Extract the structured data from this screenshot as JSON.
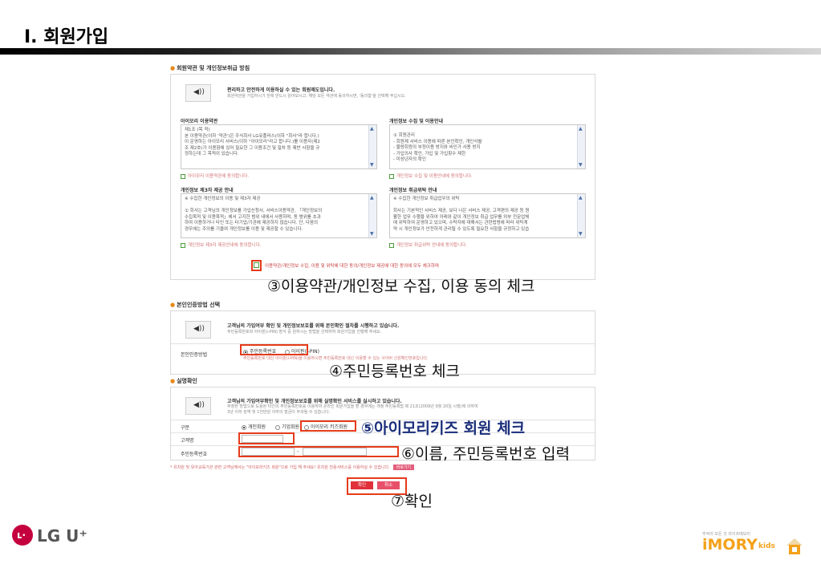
{
  "slide": {
    "title": "I. 회원가입"
  },
  "terms": {
    "section_title": "회원약관 및 개인정보취급 방침",
    "intro_icon": "speaker-icon",
    "intro_title": "편리하고 안전하게 이용하실 수 있는 회원제도입니다.",
    "intro_sub": "회원약관을 가입하시기 전에 반드시 읽어보시고, 해당 모든 약관에 동의하시면, '동의함'을 선택해 주십시오.",
    "boxes": [
      {
        "title": "아이모리 이용약관",
        "text": "제1조 (목 적)\n본 이용약관(이하 '약관')은 주식회사 LG유플러스(이하 \"회사\"라 합니다.)\n이 운영하는 아이모리 서비스(이하 \"아이모리\"라고 합니다.)를 이용자(제2\n조 제2호)가 이용함에 있어 필요한 그 이용조건 및 절차 등 제반 사항을 규\n정하는데 그 목적이 있습니다.",
        "agree": "아이모리 이용약관에 동의합니다."
      },
      {
        "title": "개인정보 수집 및 이용안내",
        "text": "① 회원관리\n- 회원제 서비스 이용에 따른 본인확인, 개인식별\n- 불량회원의 부정이용 방지와 비인가 사용 방지\n- 가입의사 확인, 가입 및 가입횟수 제한\n- 미성년자의 확인",
        "agree": "개인정보 수집 및 이용안내에 동의합니다."
      },
      {
        "title": "개인정보 제3자 제공 안내",
        "text": "※ 수집한 개인정보의 이용 및 제3자 제공\n\n① 회사는 고객님의 개인정보를 가입신청서, 서비스이용약관, 「개인정보의\n수집목적 및 이용목적」에서 고지한 범위 내에서 사용하며, 동 범위를 초과\n하여 이용하거나 타인 또는 타기업/기관에 제공하지 않습니다. 단, 다음의\n경우에는 주의를 기울여 개인정보를 이용 및 제공할 수 있습니다.",
        "agree": "개인정보 제3자 제공안내에 동의합니다."
      },
      {
        "title": "개인정보 취급위탁 안내",
        "text": "※ 수집한 개인정보 취급업무의 위탁\n\n회사는 기본적인 서비스 제공, 보다 나은 서비스 제공, 고객편의 제공 등 원\n활한 업무 수행을 위하여 아래와 같이 개인정보 취급 업무를 외부 전문업체\n에 위탁하여 운영하고 있으며, 수탁자에 대해서는 관련법령에 따라 위탁계\n약 시 개인정보가 안전하게 관리될 수 있도록 필요한 사항을 규정하고 있습",
        "agree": "개인정보 취급위탁 안내에 동의합니다."
      }
    ],
    "all_agree": "이용약관/개인정보 수집, 이용 및 위탁에 대한 동의/개인정보 제공에 대한 동의에 모두 체크하며"
  },
  "auth": {
    "section_title": "본인인증방법 선택",
    "intro_title": "고객님의 가입여부 확인 및 개인정보보호를 위해 본인확인 절차를 시행하고 있습니다.",
    "intro_sub": "주민등록번호와 아이핀(i-PIN) 방식 중 원하시는 방법을 선택하여 회원가입을 진행해 주세요.",
    "row_label": "본인인증방법",
    "option_ssn": "주민등록번호",
    "option_ipin": "아이핀(i-PIN)",
    "hint": "주민등록번호 대신 아이핀(i-PIN)을 이용하시면 주민등록번호 대신 이용할 수 있는 사이버 신원확인번호입니다."
  },
  "realname": {
    "section_title": "실명확인",
    "intro_title": "고객님의 가입여부확인 및 개인정보보호를 위해 실명확인 서비스를 실시하고 있습니다.",
    "intro_sub1": "부정한 방법으로 도용된 타인의 주민등록번호를 이용하여 온라인 회원가입을 할 경우에는 개정 주민등록법 제 21조(2009년 9월 20일 시행)에 의하여",
    "intro_sub2": "3년 이하 징역 및 1천만원 이하의 벌금이 부과될 수 있습니다.",
    "labels": {
      "type": "구분",
      "name": "고객명",
      "ssn": "주민등록번호"
    },
    "type_options": [
      "개인회원",
      "기업회원",
      "아이모리 키즈회원"
    ],
    "name_value": "",
    "ssn_front": "",
    "ssn_back": "",
    "footer_note": "* 유치원 및 유아교육기관 관련 고객님께서는 \"아이모리키즈 회원\"으로 가입 해 주세요! 유치원 전용서비스를 이용하실 수 있습니다.",
    "footer_button": "바로가기"
  },
  "buttons": {
    "confirm": "확인",
    "cancel": "취소"
  },
  "annotations": {
    "a3": "③이용약관/개인정보 수집, 이용 동의 체크",
    "a4": "④주민등록번호 체크",
    "a5": "⑤아이모리키즈 회원 체크",
    "a6": "⑥이름, 주민등록번호 입력",
    "a7": "⑦확인"
  },
  "brand": {
    "lg_text": "LG U⁺",
    "imory_tagline": "추억의 모든 것 라이프메모리",
    "imory_word": "iMORY",
    "imory_kids": "kids"
  },
  "colors": {
    "accent_orange": "#e8891b",
    "highlight_red": "#e53b1a",
    "button_red": "#e0303a",
    "annotation_blue": "#1a2e7a",
    "lg_red": "#c4003e",
    "imory_orange": "#f4a21b"
  }
}
